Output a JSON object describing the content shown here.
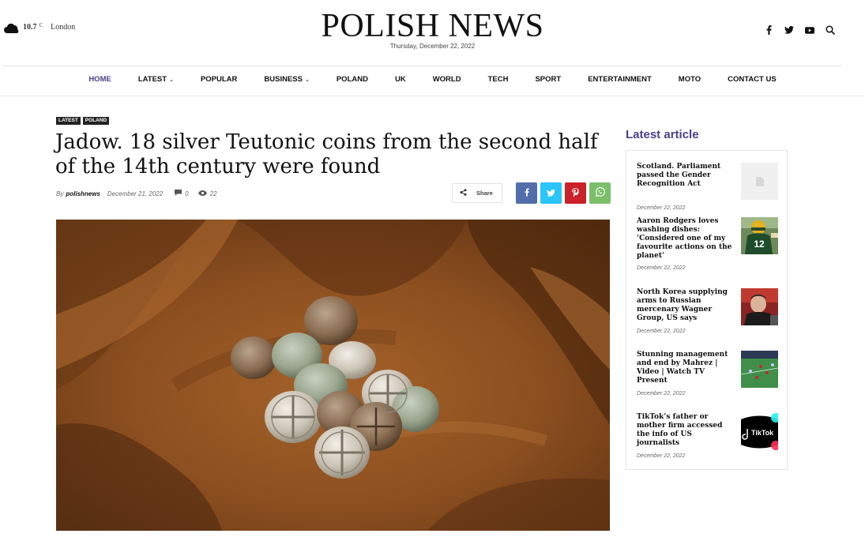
{
  "header": {
    "weather_temp": "10.7",
    "weather_unit": "C",
    "weather_city": "London",
    "logo": "POLISH NEWS",
    "date": "Thursday, December 22, 2022",
    "social_icons": [
      "facebook-icon",
      "twitter-icon",
      "youtube-icon",
      "search-icon"
    ]
  },
  "nav": {
    "items": [
      {
        "label": "HOME",
        "dropdown": false
      },
      {
        "label": "LATEST",
        "dropdown": true
      },
      {
        "label": "POPULAR",
        "dropdown": false
      },
      {
        "label": "BUSINESS",
        "dropdown": true
      },
      {
        "label": "POLAND",
        "dropdown": false
      },
      {
        "label": "UK",
        "dropdown": false
      },
      {
        "label": "WORLD",
        "dropdown": false
      },
      {
        "label": "TECH",
        "dropdown": false
      },
      {
        "label": "SPORT",
        "dropdown": false
      },
      {
        "label": "ENTERTAINMENT",
        "dropdown": false
      },
      {
        "label": "MOTO",
        "dropdown": false
      },
      {
        "label": "CONTACT US",
        "dropdown": false
      }
    ]
  },
  "article": {
    "tags": [
      "LATEST",
      "POLAND"
    ],
    "title": "Jadow. 18 silver Teutonic coins from the second half of the 14th century were found",
    "by": "By",
    "author": "polishnews",
    "date": "December 21, 2022",
    "comments": "0",
    "views": "22",
    "share_label": "Share"
  },
  "colors": {
    "accent": "#4b3f8a",
    "facebook": "#516eab",
    "twitter": "#29c5f6",
    "pinterest": "#ca212a",
    "whatsapp": "#7bbf6a"
  },
  "sidebar": {
    "title": "Latest article",
    "items": [
      {
        "title": "Scotland. Parliament passed the Gender Recognition Act",
        "date": "December 22, 2022"
      },
      {
        "title": "Aaron Rodgers loves washing dishes: ‘Considered one of my favourite actions on the planet’",
        "date": "December 22, 2022"
      },
      {
        "title": "North Korea supplying arms to Russian mercenary Wagner Group, US says",
        "date": "December 22, 2022"
      },
      {
        "title": "Stunning management and end by Mahrez | Video | Watch TV Present",
        "date": "December 22, 2022"
      },
      {
        "title": "TikTok’s father or mother firm accessed the info of US journalists",
        "date": "December 22, 2022"
      }
    ]
  }
}
